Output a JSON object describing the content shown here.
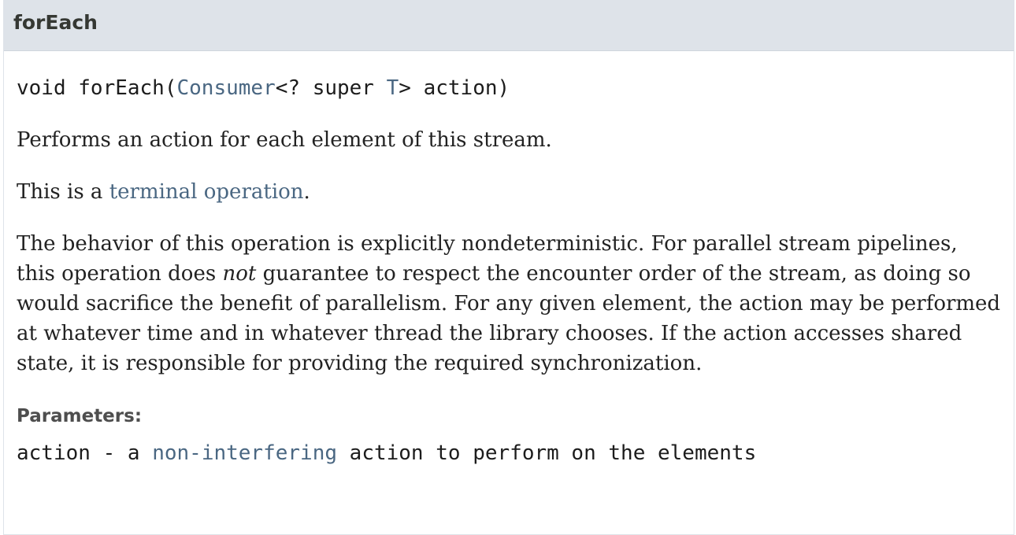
{
  "method": {
    "name": "forEach",
    "signature": {
      "prefix": "void forEach(",
      "param_type": "Consumer",
      "middle": "<? super ",
      "type_var": "T",
      "suffix": "> action)"
    },
    "description": "Performs an action for each element of this stream.",
    "terminal": {
      "prefix": "This is a ",
      "link": "terminal operation",
      "suffix": "."
    },
    "behavior": {
      "part1": "The behavior of this operation is explicitly nondeterministic. For parallel stream pipelines, this operation does ",
      "emphasis": "not",
      "part2": " guarantee to respect the encounter order of the stream, as doing so would sacrifice the benefit of parallelism. For any given element, the action may be performed at whatever time and in whatever thread the library chooses. If the action accesses shared state, it is responsible for providing the required synchronization."
    },
    "parameters": {
      "label": "Parameters:",
      "items": [
        {
          "name": "action",
          "dash": " - a ",
          "link": "non-interfering",
          "rest": " action to perform on the elements"
        }
      ]
    }
  },
  "colors": {
    "header_bg": "#dee3e9",
    "link": "#4a6782",
    "text": "#222222"
  }
}
